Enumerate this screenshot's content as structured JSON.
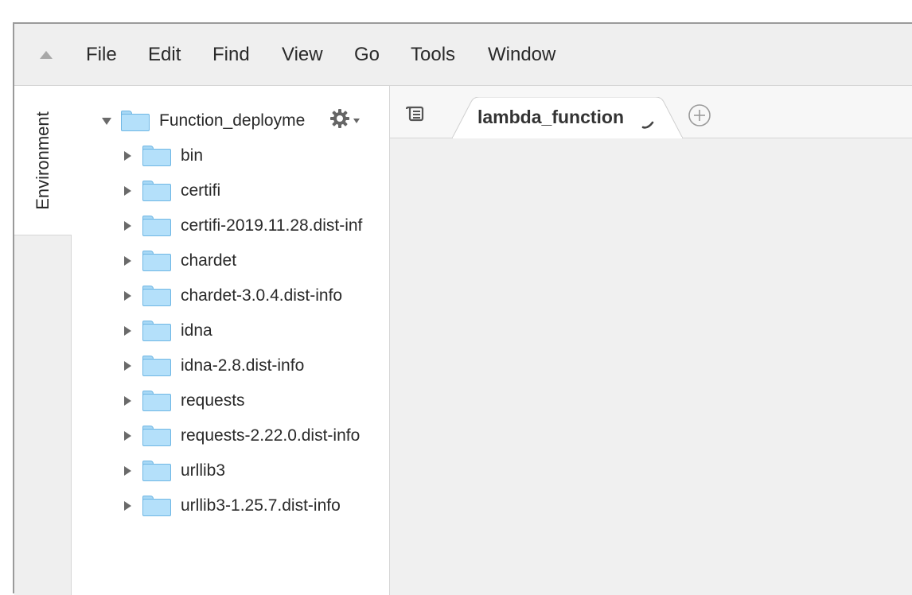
{
  "menu": {
    "items": [
      "File",
      "Edit",
      "Find",
      "View",
      "Go",
      "Tools",
      "Window"
    ],
    "collapse_icon": "triangle-up-icon"
  },
  "side_tabs": {
    "environment_label": "Environment"
  },
  "tree": {
    "root": {
      "label": "Function_deployme",
      "expanded": true,
      "settings_icon": "gear-icon"
    },
    "children": [
      {
        "label": "bin"
      },
      {
        "label": "certifi"
      },
      {
        "label": "certifi-2019.11.28.dist-inf"
      },
      {
        "label": "chardet"
      },
      {
        "label": "chardet-3.0.4.dist-info"
      },
      {
        "label": "idna"
      },
      {
        "label": "idna-2.8.dist-info"
      },
      {
        "label": "requests"
      },
      {
        "label": "requests-2.22.0.dist-info"
      },
      {
        "label": "urllib3"
      },
      {
        "label": "urllib3-1.25.7.dist-info"
      }
    ]
  },
  "editor": {
    "tabs": [
      {
        "label": "lambda_function",
        "status": "loading"
      }
    ],
    "tab_list_icon": "scroll-icon",
    "add_tab_icon": "plus-circle-icon"
  },
  "colors": {
    "folder_fill": "#b4e0fa",
    "folder_stroke": "#6fb7e4",
    "chrome_bg": "#efefef",
    "text": "#2a2a2a"
  }
}
